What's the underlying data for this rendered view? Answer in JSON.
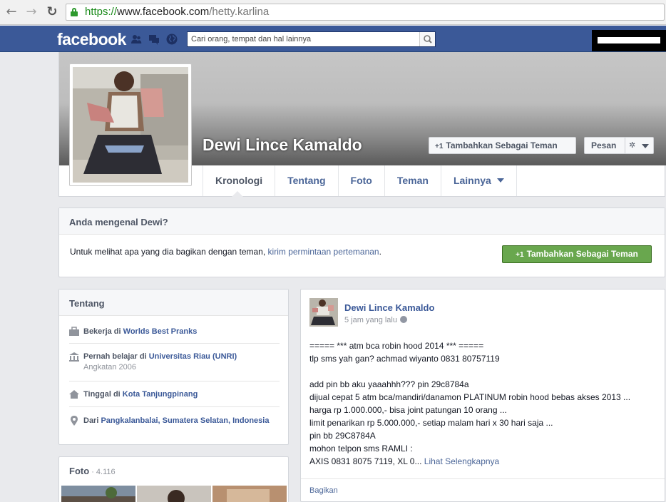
{
  "browser": {
    "url_scheme": "https://",
    "url_host": "www.facebook.com",
    "url_path": "/hetty.karlina"
  },
  "fb": {
    "logo": "facebook",
    "search_placeholder": "Cari orang, tempat dan hal lainnya"
  },
  "profile": {
    "name": "Dewi Lince Kamaldo",
    "add_friend": "Tambahkan Sebagai Teman",
    "message": "Pesan",
    "tabs": [
      "Kronologi",
      "Tentang",
      "Foto",
      "Teman",
      "Lainnya"
    ]
  },
  "know": {
    "title": "Anda mengenal Dewi?",
    "text": "Untuk melihat apa yang dia bagikan dengan teman, ",
    "link": "kirim permintaan pertemanan",
    "after": ".",
    "button": "Tambahkan Sebagai Teman"
  },
  "about": {
    "title": "Tentang",
    "work_prefix": "Bekerja di ",
    "work": "Worlds Best Pranks",
    "edu_prefix": "Pernah belajar di ",
    "edu": "Universitas Riau (UNRI)",
    "edu_sub": "Angkatan 2006",
    "live_prefix": "Tinggal di ",
    "live": "Kota Tanjungpinang",
    "from_prefix": "Dari ",
    "from": "Pangkalanbalai, Sumatera Selatan, Indonesia"
  },
  "photos": {
    "title": "Foto",
    "count": " · 4.116"
  },
  "post": {
    "author": "Dewi Lince Kamaldo",
    "time": "5 jam yang lalu",
    "lines": [
      "===== *** atm bca robin hood 2014 *** =====",
      "tlp sms yah gan? achmad wiyanto 0831 80757119",
      "",
      "add pin bb aku yaaahhh??? pin 29c8784a",
      "dijual cepat 5 atm bca/mandiri/danamon PLATINUM robin hood bebas akses 2013 ...",
      "harga rp 1.000.000,- bisa joint patungan 10 orang ...",
      "limit penarikan rp 5.000.000,- setiap malam hari x 30 hari saja ...",
      "pin bb 29C8784A",
      "mohon telpon sms RAMLI :"
    ],
    "last_line": "AXIS 0831 8075 7119, XL 0... ",
    "see_more": "Lihat Selengkapnya",
    "share": "Bagikan"
  }
}
